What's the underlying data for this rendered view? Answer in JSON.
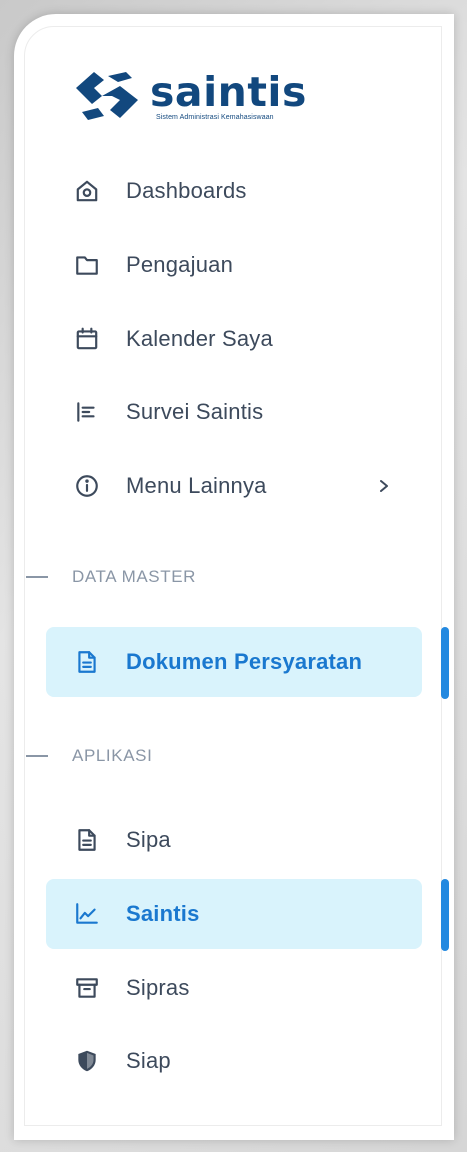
{
  "logo": {
    "name": "saintis",
    "tagline": "Sistem Administrasi Kemahasiswaan"
  },
  "nav": {
    "items": [
      {
        "label": "Dashboards",
        "icon": "home-icon"
      },
      {
        "label": "Pengajuan",
        "icon": "folder-icon"
      },
      {
        "label": "Kalender Saya",
        "icon": "calendar-icon"
      },
      {
        "label": "Survei Saintis",
        "icon": "align-left-icon"
      },
      {
        "label": "Menu Lainnya",
        "icon": "info-icon",
        "has_submenu": true
      }
    ]
  },
  "sections": {
    "data_master": {
      "title": "DATA MASTER",
      "items": [
        {
          "label": "Dokumen Persyaratan",
          "icon": "document-icon",
          "active": true
        }
      ]
    },
    "aplikasi": {
      "title": "APLIKASI",
      "items": [
        {
          "label": "Sipa",
          "icon": "document-icon"
        },
        {
          "label": "Saintis",
          "icon": "chart-line-icon",
          "active": true
        },
        {
          "label": "Sipras",
          "icon": "archive-icon"
        },
        {
          "label": "Siap",
          "icon": "shield-icon"
        }
      ]
    }
  },
  "colors": {
    "brand": "#12487e",
    "active_text": "#1a78cf",
    "active_bg": "#d9f3fc",
    "active_bar": "#2389e0",
    "text": "#3d4a5c",
    "section_title": "#8a96a6"
  }
}
